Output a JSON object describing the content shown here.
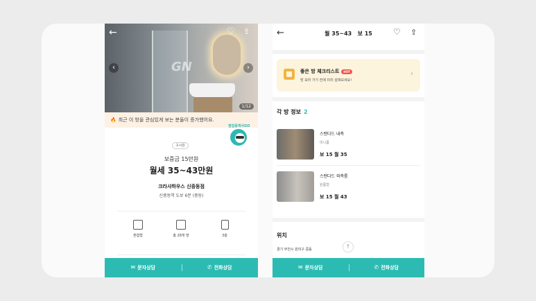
{
  "listing": {
    "photo_counter": "1/12",
    "watermark": "GN",
    "notice": "최근 이 방을 관심있게 보는 분들이 증가했어요.",
    "mascot_label": "옆집중개사GO",
    "badge": "고시원",
    "deposit": "보증금 15만원",
    "monthly_rent": "월세 35~43만원",
    "building_name": "크라샤하우스 신중동점",
    "walk_info": "신중동역 도보 6분 (중동)",
    "specs": [
      {
        "icon": "house-icon",
        "label": "혼합형"
      },
      {
        "icon": "floorplan-icon",
        "label": "총 28개 방"
      },
      {
        "icon": "building-icon",
        "label": "3층"
      }
    ]
  },
  "detail": {
    "title": "월 35~43   보 15",
    "checklist": {
      "title": "좋은 방 체크리스트",
      "hot_badge": "HOT",
      "subtitle": "방 보러 가기 전에 미리 살펴보세요!"
    },
    "rooms_section_title": "각 방 정보",
    "rooms_count": "2",
    "rooms": [
      {
        "name": "스탠다드 내측",
        "type": "미니룸",
        "price": "보 15 월 35"
      },
      {
        "name": "스탠다드 외측룸",
        "type": "원룸형",
        "price": "보 15 월 43"
      }
    ],
    "location_title": "위치",
    "location_address": "경기 부천시 원미구 중동"
  },
  "actions": {
    "message_label": "문자상담",
    "call_label": "전화상담"
  },
  "colors": {
    "accent": "#2cbbb3",
    "notice_bg": "#fdf1e4",
    "checklist_bg": "#fdf4de",
    "hot": "#f2554b"
  }
}
